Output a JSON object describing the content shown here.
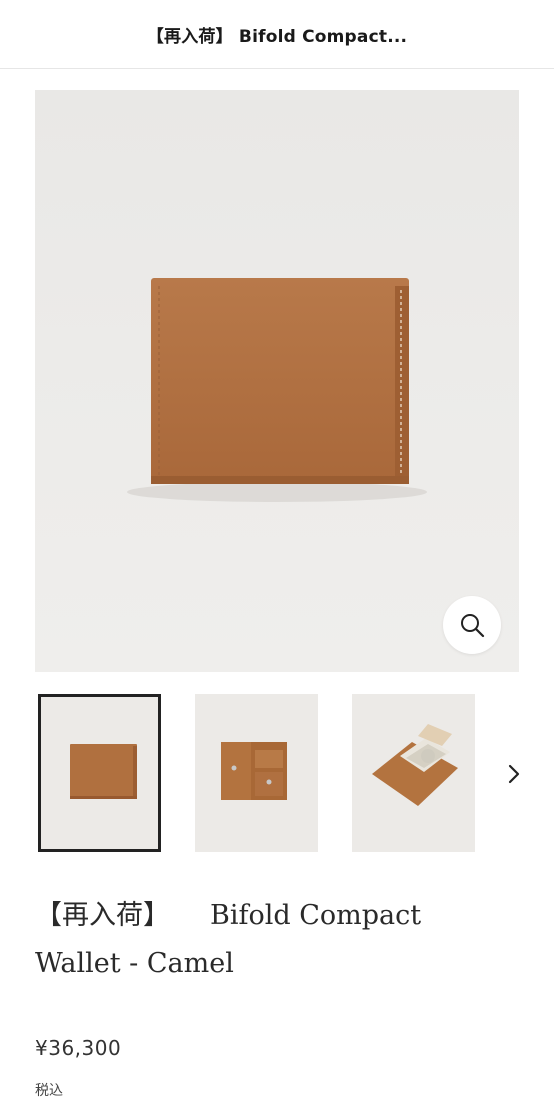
{
  "header": {
    "title": "【再入荷】 Bifold Compact..."
  },
  "gallery": {
    "main_image": "camel-bifold-wallet-closed",
    "zoom_icon": "search-icon",
    "thumbnails": [
      {
        "image": "wallet-closed",
        "selected": true
      },
      {
        "image": "wallet-open-inside",
        "selected": false
      },
      {
        "image": "wallet-open-with-cards",
        "selected": false
      }
    ],
    "next_icon": "chevron-right-icon"
  },
  "product": {
    "title_prefix": "【再入荷】",
    "title_line1": "Bifold Compact",
    "title_line2": "Wallet - Camel",
    "price": "¥36,300",
    "tax_note": "税込"
  },
  "colors": {
    "leather": "#b06f3c",
    "background": "#ecebe9",
    "text": "#2a2a2a"
  }
}
